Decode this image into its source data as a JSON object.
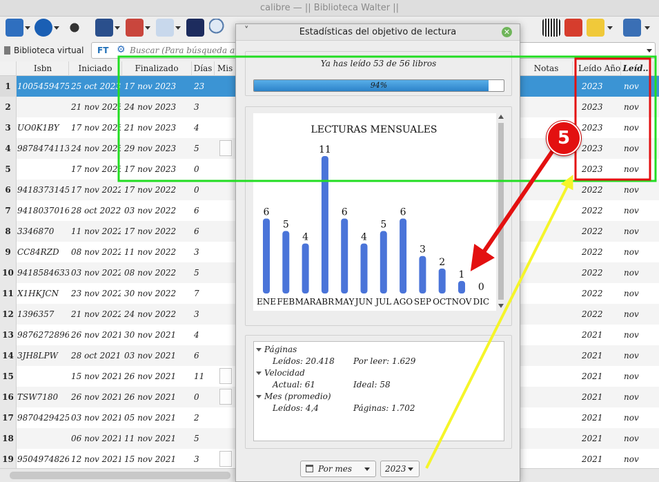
{
  "window": {
    "title": "calibre — || Biblioteca Walter ||"
  },
  "search": {
    "virtual_library": "Biblioteca virtual",
    "ft_label": "FT",
    "placeholder": "Buscar (Para búsqueda avan"
  },
  "table": {
    "headers": {
      "isbn": "Isbn",
      "iniciado": "Iniciado",
      "finalizado": "Finalizado",
      "dias": "Días",
      "mis": "Mis",
      "notas": "Notas",
      "leido_anio": "Leído Año",
      "leido_mes": "Leíd…"
    },
    "rows": [
      {
        "n": "1",
        "isbn": "1005459475",
        "ini": "25 oct 2023",
        "fin": "17 nov 2023",
        "dias": "23",
        "anio": "2023",
        "mes": "nov"
      },
      {
        "n": "2",
        "isbn": "",
        "ini": "21 nov 2023",
        "fin": "24 nov 2023",
        "dias": "3",
        "anio": "2023",
        "mes": "nov"
      },
      {
        "n": "3",
        "isbn": "UO0K1BY",
        "ini": "17 nov 2023",
        "fin": "21 nov 2023",
        "dias": "4",
        "anio": "2023",
        "mes": "nov"
      },
      {
        "n": "4",
        "isbn": "9878474113",
        "ini": "24 nov 2023",
        "fin": "29 nov 2023",
        "dias": "5",
        "anio": "2023",
        "mes": "nov"
      },
      {
        "n": "5",
        "isbn": "",
        "ini": "17 nov 2023",
        "fin": "17 nov 2023",
        "dias": "0",
        "anio": "2023",
        "mes": "nov"
      },
      {
        "n": "6",
        "isbn": "9418373145",
        "ini": "17 nov 2022",
        "fin": "17 nov 2022",
        "dias": "0",
        "anio": "2022",
        "mes": "nov"
      },
      {
        "n": "7",
        "isbn": "9418037016",
        "ini": "28 oct 2022",
        "fin": "03 nov 2022",
        "dias": "6",
        "anio": "2022",
        "mes": "nov"
      },
      {
        "n": "8",
        "isbn": "3346870",
        "ini": "11 nov 2022",
        "fin": "17 nov 2022",
        "dias": "6",
        "anio": "2022",
        "mes": "nov"
      },
      {
        "n": "9",
        "isbn": "CC84RZD",
        "ini": "08 nov 2022",
        "fin": "11 nov 2022",
        "dias": "3",
        "anio": "2022",
        "mes": "nov"
      },
      {
        "n": "10",
        "isbn": "9418584633",
        "ini": "03 nov 2022",
        "fin": "08 nov 2022",
        "dias": "5",
        "anio": "2022",
        "mes": "nov"
      },
      {
        "n": "11",
        "isbn": "X1HKJCN",
        "ini": "23 nov 2022",
        "fin": "30 nov 2022",
        "dias": "7",
        "anio": "2022",
        "mes": "nov"
      },
      {
        "n": "12",
        "isbn": "1396357",
        "ini": "21 nov 2022",
        "fin": "24 nov 2022",
        "dias": "3",
        "anio": "2022",
        "mes": "nov"
      },
      {
        "n": "13",
        "isbn": "9876272896",
        "ini": "26 nov 2021",
        "fin": "30 nov 2021",
        "dias": "4",
        "anio": "2021",
        "mes": "nov"
      },
      {
        "n": "14",
        "isbn": "3JH8LPW",
        "ini": "28 oct 2021",
        "fin": "03 nov 2021",
        "dias": "6",
        "anio": "2021",
        "mes": "nov"
      },
      {
        "n": "15",
        "isbn": "",
        "ini": "15 nov 2021",
        "fin": "26 nov 2021",
        "dias": "11",
        "anio": "2021",
        "mes": "nov"
      },
      {
        "n": "16",
        "isbn": "TSW7180",
        "ini": "26 nov 2021",
        "fin": "26 nov 2021",
        "dias": "0",
        "anio": "2021",
        "mes": "nov"
      },
      {
        "n": "17",
        "isbn": "9870429425",
        "ini": "03 nov 2021",
        "fin": "05 nov 2021",
        "dias": "2",
        "anio": "2021",
        "mes": "nov"
      },
      {
        "n": "18",
        "isbn": "",
        "ini": "06 nov 2021",
        "fin": "11 nov 2021",
        "dias": "5",
        "anio": "2021",
        "mes": "nov"
      },
      {
        "n": "19",
        "isbn": "9504974826",
        "ini": "12 nov 2021",
        "fin": "15 nov 2021",
        "dias": "3",
        "anio": "2021",
        "mes": "nov"
      }
    ]
  },
  "dialog": {
    "title": "Estadísticas del objetivo de lectura",
    "menu_glyph": "˅",
    "close_glyph": "✕",
    "goal_text": "Ya has leído 53 de 56 libros",
    "progress_label": "94%",
    "progress_value": 94,
    "stats": {
      "paginas": {
        "label": "Páginas",
        "leidos": "Leídos:  20.418",
        "por_leer": "Por leer:  1.629"
      },
      "velocidad": {
        "label": "Velocidad",
        "actual": "Actual:  61",
        "ideal": "Ideal:   58"
      },
      "mes": {
        "label": "Mes (promedio)",
        "leidos": "Leídos:  4,4",
        "paginas": "Páginas:   1.702"
      }
    },
    "period_combo": "Por mes",
    "year_combo": "2023"
  },
  "chart_data": {
    "type": "bar",
    "title": "LECTURAS MENSUALES",
    "categories": [
      "ENE",
      "FEB",
      "MAR",
      "ABR",
      "MAY",
      "JUN",
      "JUL",
      "AGO",
      "SEP",
      "OCT",
      "NOV",
      "DIC"
    ],
    "values": [
      6,
      5,
      4,
      11,
      6,
      4,
      5,
      6,
      3,
      2,
      1,
      0
    ],
    "ylim": [
      0,
      11
    ],
    "bar_color": "#4a74d9"
  },
  "annotation": {
    "badge": "5",
    "green_color": "#22dd22",
    "red_color": "#e31010",
    "yellow_color": "#f5f52a"
  }
}
